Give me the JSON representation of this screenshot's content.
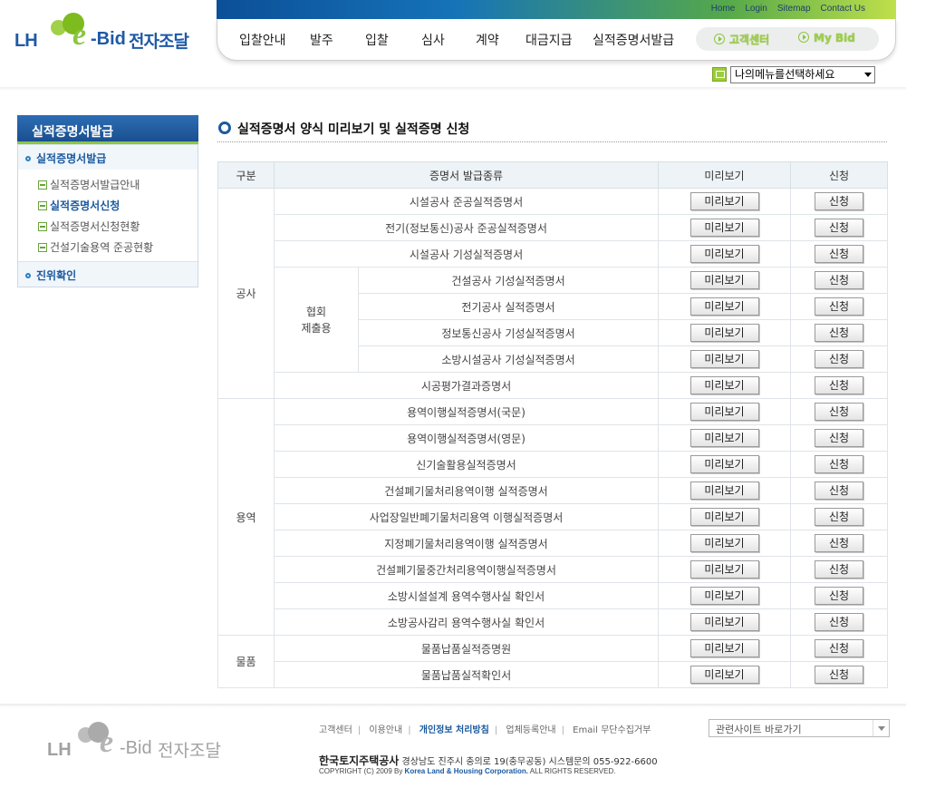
{
  "logo": {
    "lh": "LH",
    "e": "e",
    "bid": "-Bid",
    "kr": "전자조달"
  },
  "util_links": [
    "Home",
    "Login",
    "Sitemap",
    "Contact Us"
  ],
  "gnb": [
    "입찰안내",
    "발주",
    "입찰",
    "심사",
    "계약",
    "대금지급",
    "실적증명서발급"
  ],
  "quick": [
    "고객센터",
    "My Bid"
  ],
  "my_menu": {
    "value": "나의메뉴를선택하세요"
  },
  "lnb": {
    "title": "실적증명서발급",
    "dep1": "실적증명서발급",
    "dep2": [
      "실적증명서발급안내",
      "실적증명서신청",
      "실적증명서신청현황",
      "건설기술용역 준공현황"
    ],
    "dep1_b": "진위확인"
  },
  "content_title": "실적증명서 양식 미리보기 및 실적증명 신청",
  "table": {
    "headers": [
      "구분",
      "증명서 발급종류",
      "미리보기",
      "신청"
    ],
    "preview_label": "미리보기",
    "apply_label": "신청",
    "cat_construction": "공사",
    "sub_association": "협회\n제출용",
    "cat_service": "용역",
    "cat_goods": "물품",
    "construction_top": [
      "시설공사 준공실적증명서",
      "전기(정보통신)공사 준공실적증명서",
      "시설공사 기성실적증명서"
    ],
    "construction_assoc": [
      "건설공사 기성실적증명서",
      "전기공사 실적증명서",
      "정보통신공사 기성실적증명서",
      "소방시설공사 기성실적증명서"
    ],
    "construction_bottom": [
      "시공평가결과증명서"
    ],
    "service": [
      "용역이행실적증명서(국문)",
      "용역이행실적증명서(영문)",
      "신기술활용실적증명서",
      "건설폐기물처리용역이행 실적증명서",
      "사업장일반폐기물처리용역 이행실적증명서",
      "지정폐기물처리용역이행 실적증명서",
      "건설폐기물중간처리용역이행실적증명서",
      "소방시설설계 용역수행사실 확인서",
      "소방공사감리 용역수행사실 확인서"
    ],
    "goods": [
      "물품납품실적증명원",
      "물품납품실적확인서"
    ]
  },
  "footer": {
    "links": [
      "고객센터",
      "이용안내",
      "개인정보 처리방침",
      "업체등록안내",
      "Email 무단수집거부"
    ],
    "company": "한국토지주택공사",
    "address": "경상남도 진주시 충의로 19(충무공동) 시스템문의 055-922-6600",
    "copyright_a": "COPYRIGHT (C) 2009 By ",
    "copyright_b": "Korea Land & Housing Corporation.",
    "copyright_c": " ALL RIGHTS RESERVED.",
    "related_sites": "관련사이트 바로가기"
  }
}
